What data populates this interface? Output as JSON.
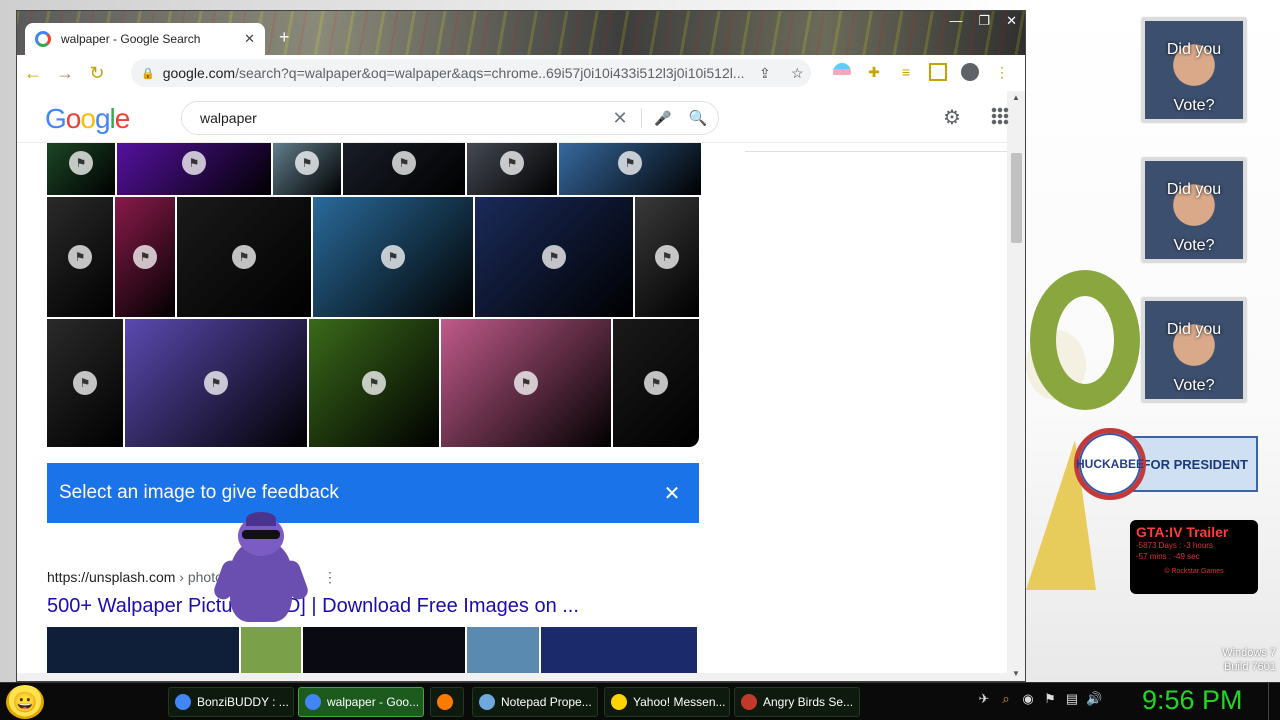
{
  "browser": {
    "tab_title": "walpaper - Google Search",
    "tab_close": "✕",
    "new_tab": "+",
    "window_buttons": [
      "—",
      "❐",
      "✕"
    ],
    "nav": {
      "back": "←",
      "forward": "→",
      "reload": "↻"
    },
    "url_host": "google.com",
    "url_path": "/search?q=walpaper&oq=walpaper&aqs=chrome..69i57j0i10i433i512l3j0i10i512l..."
  },
  "google": {
    "logo": [
      "G",
      "o",
      "o",
      "g",
      "l",
      "e"
    ],
    "query": "walpaper",
    "clear": "✕"
  },
  "feedback": {
    "text": "Select an image to give feedback",
    "close": "✕"
  },
  "result": {
    "site": "https://unsplash.com",
    "crumb": " › photos › walpaper",
    "menu": "⋮",
    "title": "500+ Walpaper Pictures [HD] | Download Free Images on ..."
  },
  "desktop": {
    "vote_cards": [
      {
        "line1": "Did you",
        "line2": "Vote?"
      },
      {
        "line1": "Did you",
        "line2": "Vote?"
      },
      {
        "line1": "Did you",
        "line2": "Vote?"
      }
    ],
    "huckabee": {
      "badge": "HUCKABEE",
      "text": "FOR PRESIDENT"
    },
    "gta": {
      "title": "GTA:IV Trailer",
      "line1": "-5873 Days : -3 hours",
      "line2": "-57 mins : -49 sec",
      "footer": "© Rockstar Games"
    },
    "winver": {
      "line1": "Windows 7",
      "line2": "Build 7601"
    }
  },
  "taskbar": {
    "items": [
      {
        "label": "BonziBUDDY : ...",
        "color": "#4285f4"
      },
      {
        "label": "walpaper - Goo...",
        "color": "#4285f4"
      },
      {
        "label": "",
        "color": "#ff7a00"
      },
      {
        "label": "Notepad Prope...",
        "color": "#6fa8dc"
      },
      {
        "label": "Yahoo! Messen...",
        "color": "#ffd400"
      },
      {
        "label": "Angry Birds Se...",
        "color": "#c0392b"
      }
    ],
    "clock": "9:56 PM"
  },
  "images": {
    "row1_colors": [
      "#1f4d2a",
      "#5a12a8",
      "#6b8a9a",
      "#1a1f2a",
      "#4a4f5a",
      "#3a6fa8"
    ],
    "row2_colors": [
      "#2a2a2a",
      "#8a1a4a",
      "#1a1a1a",
      "#2a6a9a",
      "#1a2a5a",
      "#3a3a3a"
    ],
    "row3_colors": [
      "#2a2a2a",
      "#5a4ab0",
      "#3a6a1a",
      "#c05a8a",
      "#1a1a1a"
    ],
    "strip_colors": [
      "#0f1f3a",
      "#7aa04a",
      "#0a0a12",
      "#5a8ab0",
      "#1a2a6a"
    ]
  }
}
